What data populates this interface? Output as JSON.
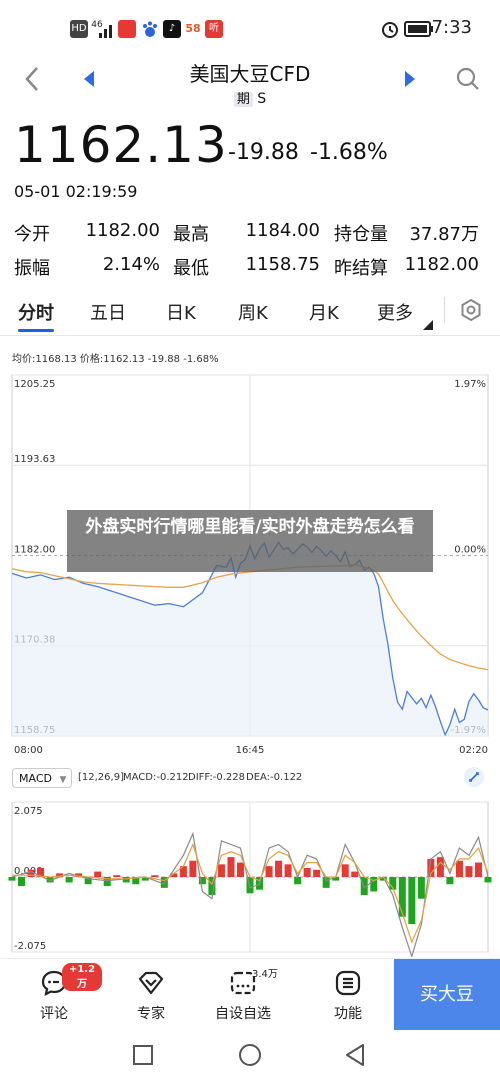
{
  "status_bar": {
    "time": "7:33",
    "signal_text": "46",
    "app_icons": [
      "hd-icon",
      "signal-icon",
      "wifi-icon",
      "app-red-icon",
      "baidu-paw-icon",
      "tiktok-icon",
      "58-icon",
      "ting-icon"
    ],
    "app_58_label": "58",
    "ting_label": "听",
    "hd_label": "HD"
  },
  "header": {
    "title": "美国大豆CFD",
    "subtitle_tag": "期",
    "subtitle": "S"
  },
  "quote": {
    "price": "1162.13",
    "change": "-19.88",
    "change_pct": "-1.68%",
    "datetime": "05-01 02:19:59",
    "stats": [
      {
        "label": "今开",
        "value": "1182.00"
      },
      {
        "label": "最高",
        "value": "1184.00"
      },
      {
        "label": "持仓量",
        "value": "37.87万"
      },
      {
        "label": "振幅",
        "value": "2.14%"
      },
      {
        "label": "最低",
        "value": "1158.75"
      },
      {
        "label": "昨结算",
        "value": "1182.00"
      }
    ]
  },
  "tabs": [
    {
      "label": "分时"
    },
    {
      "label": "五日"
    },
    {
      "label": "日K"
    },
    {
      "label": "周K"
    },
    {
      "label": "月K"
    },
    {
      "label": "更多"
    }
  ],
  "chart_info": {
    "line": "均价:1168.13  价格:1162.13  -19.88  -1.68%"
  },
  "overlay_text": "外盘实时行情哪里能看/实时外盘走势怎么看",
  "macd": {
    "selector": "MACD",
    "params": "[12,26,9]",
    "macd_val": "MACD:-0.212",
    "diff_val": "DIFF:-0.228",
    "dea_val": "DEA:-0.122"
  },
  "bottom_bar": {
    "items": [
      {
        "label": "评论",
        "badge": "+1.2万"
      },
      {
        "label": "专家"
      },
      {
        "label": "自设自选",
        "badge_plain": "3.4万"
      },
      {
        "label": "功能"
      }
    ],
    "buy": "买大豆"
  },
  "colors": {
    "accent": "#1f5eea",
    "price_line": "#4a7fd6",
    "avg_line": "#e8a24a",
    "up": "#e53935",
    "down": "#1ea51e",
    "buy_button": "#4d86ea",
    "badge": "#e53935"
  },
  "chart_data": [
    {
      "type": "line",
      "title": "",
      "yticks": [
        "1205.25",
        "1193.63",
        "1182.00",
        "1170.38",
        "1158.75"
      ],
      "ylim": [
        1158.75,
        1205.25
      ],
      "pct_ticks": [
        "1.97%",
        "0.00%",
        "-1.97%"
      ],
      "xticks": [
        "08:00",
        "16:45",
        "02:20"
      ],
      "series": [
        {
          "name": "价格",
          "x": [
            0,
            3,
            6,
            9,
            12,
            15,
            18,
            21,
            24,
            27,
            30,
            33,
            36,
            40,
            43,
            45,
            46,
            47,
            48,
            49,
            50,
            51,
            52,
            53,
            54,
            55,
            56,
            57,
            58,
            59,
            60,
            61,
            62,
            63,
            64,
            65,
            66,
            67,
            68,
            69,
            70,
            71,
            72,
            73,
            74,
            75,
            76,
            77,
            78,
            79,
            80,
            81,
            82,
            83,
            84,
            85,
            86,
            87,
            88,
            89,
            90,
            91,
            92,
            93,
            94,
            95,
            96,
            97,
            98,
            99,
            100
          ],
          "values": [
            1179.7,
            1179.1,
            1179.5,
            1178.9,
            1179.2,
            1178.4,
            1178.0,
            1177.4,
            1176.8,
            1176.2,
            1175.6,
            1175.8,
            1175.4,
            1177.2,
            1180.7,
            1180.5,
            1181.7,
            1179.2,
            1181.0,
            1181.5,
            1183.2,
            1181.6,
            1182.8,
            1183.6,
            1181.8,
            1182.7,
            1183.7,
            1182.8,
            1183.0,
            1182.2,
            1182.8,
            1183.5,
            1183.1,
            1182.4,
            1183.2,
            1182.6,
            1181.9,
            1182.6,
            1182.0,
            1181.2,
            1182.5,
            1180.6,
            1180.8,
            1181.4,
            1180.1,
            1180.5,
            1179.7,
            1178.0,
            1173.8,
            1170.5,
            1166.2,
            1163.1,
            1162.2,
            1164.5,
            1163.7,
            1162.9,
            1163.6,
            1162.4,
            1164.0,
            1162.5,
            1160.6,
            1158.9,
            1160.2,
            1162.2,
            1160.5,
            1160.9,
            1163.2,
            1164.2,
            1163.4,
            1162.4,
            1162.1
          ]
        },
        {
          "name": "均价",
          "x": [
            0,
            3,
            6,
            9,
            12,
            15,
            18,
            21,
            24,
            27,
            30,
            33,
            36,
            40,
            43,
            46,
            50,
            55,
            60,
            65,
            70,
            72,
            74,
            76,
            77,
            78,
            79,
            80,
            81,
            82,
            84,
            86,
            88,
            90,
            92,
            94,
            96,
            98,
            100
          ],
          "values": [
            1180.3,
            1179.9,
            1179.8,
            1179.4,
            1179.0,
            1178.6,
            1178.4,
            1178.3,
            1178.2,
            1178.1,
            1178.0,
            1177.9,
            1177.9,
            1178.5,
            1179.2,
            1179.6,
            1179.9,
            1180.2,
            1180.5,
            1180.6,
            1180.7,
            1180.8,
            1180.5,
            1180.1,
            1179.6,
            1178.5,
            1177.3,
            1176.2,
            1175.3,
            1174.5,
            1173.0,
            1171.6,
            1170.4,
            1169.3,
            1168.6,
            1168.2,
            1167.8,
            1167.5,
            1167.3
          ]
        }
      ]
    },
    {
      "type": "bar",
      "title": "MACD",
      "yticks": [
        "2.075",
        "0.000",
        "-2.075"
      ],
      "ylim": [
        -2.075,
        2.075
      ],
      "series": [
        {
          "name": "MACD",
          "x": [
            0,
            2,
            4,
            6,
            8,
            10,
            12,
            14,
            16,
            18,
            20,
            22,
            24,
            26,
            28,
            30,
            32,
            34,
            36,
            38,
            40,
            42,
            44,
            46,
            48,
            50,
            52,
            54,
            56,
            58,
            60,
            62,
            64,
            66,
            68,
            70,
            72,
            74,
            76,
            78,
            80,
            82,
            84,
            86,
            88,
            90,
            92,
            94,
            96,
            98,
            100
          ],
          "values": [
            -0.1,
            -0.25,
            0.2,
            0.25,
            -0.15,
            0.1,
            -0.15,
            0.1,
            -0.2,
            0.15,
            -0.25,
            0.05,
            -0.15,
            -0.2,
            -0.1,
            0.05,
            -0.3,
            0.1,
            0.3,
            0.45,
            -0.2,
            -0.5,
            0.35,
            0.55,
            0.4,
            -0.45,
            -0.35,
            0.3,
            0.45,
            0.35,
            -0.2,
            0.25,
            0.2,
            -0.3,
            -0.1,
            0.35,
            0.15,
            -0.5,
            -0.4,
            -0.1,
            -0.35,
            -1.1,
            -1.3,
            -0.6,
            0.5,
            0.55,
            -0.2,
            0.45,
            0.3,
            0.4,
            -0.15
          ]
        },
        {
          "name": "DIFF",
          "x": [
            0,
            4,
            8,
            12,
            16,
            20,
            24,
            28,
            32,
            36,
            38,
            40,
            42,
            44,
            46,
            48,
            50,
            52,
            54,
            56,
            58,
            60,
            62,
            64,
            66,
            68,
            70,
            72,
            74,
            76,
            78,
            80,
            82,
            84,
            86,
            88,
            90,
            92,
            94,
            96,
            98,
            100
          ],
          "values": [
            0.0,
            0.15,
            -0.1,
            0.1,
            -0.05,
            -0.1,
            -0.05,
            0.0,
            -0.2,
            0.6,
            1.2,
            -0.4,
            -0.6,
            1.0,
            0.9,
            0.8,
            -0.3,
            -0.2,
            0.8,
            0.9,
            0.7,
            0.0,
            0.6,
            0.5,
            -0.1,
            0.0,
            0.9,
            0.4,
            -0.3,
            -0.1,
            0.0,
            -0.5,
            -1.4,
            -2.2,
            -1.3,
            0.5,
            0.7,
            0.1,
            0.8,
            0.6,
            1.1,
            0.0
          ]
        },
        {
          "name": "DEA",
          "x": [
            0,
            4,
            8,
            12,
            16,
            20,
            24,
            28,
            32,
            36,
            38,
            40,
            42,
            44,
            46,
            48,
            50,
            52,
            54,
            56,
            58,
            60,
            62,
            64,
            66,
            68,
            70,
            72,
            74,
            76,
            78,
            80,
            82,
            84,
            86,
            88,
            90,
            92,
            94,
            96,
            98,
            100
          ],
          "values": [
            0.05,
            0.05,
            0.0,
            0.05,
            0.0,
            -0.05,
            -0.05,
            0.0,
            -0.1,
            0.3,
            0.9,
            0.1,
            -0.2,
            0.6,
            0.7,
            0.6,
            0.0,
            -0.1,
            0.5,
            0.7,
            0.6,
            0.1,
            0.4,
            0.4,
            0.0,
            0.0,
            0.6,
            0.4,
            0.0,
            -0.1,
            0.0,
            -0.3,
            -1.0,
            -1.8,
            -1.2,
            0.1,
            0.4,
            0.2,
            0.5,
            0.5,
            0.8,
            0.1
          ]
        }
      ]
    }
  ]
}
